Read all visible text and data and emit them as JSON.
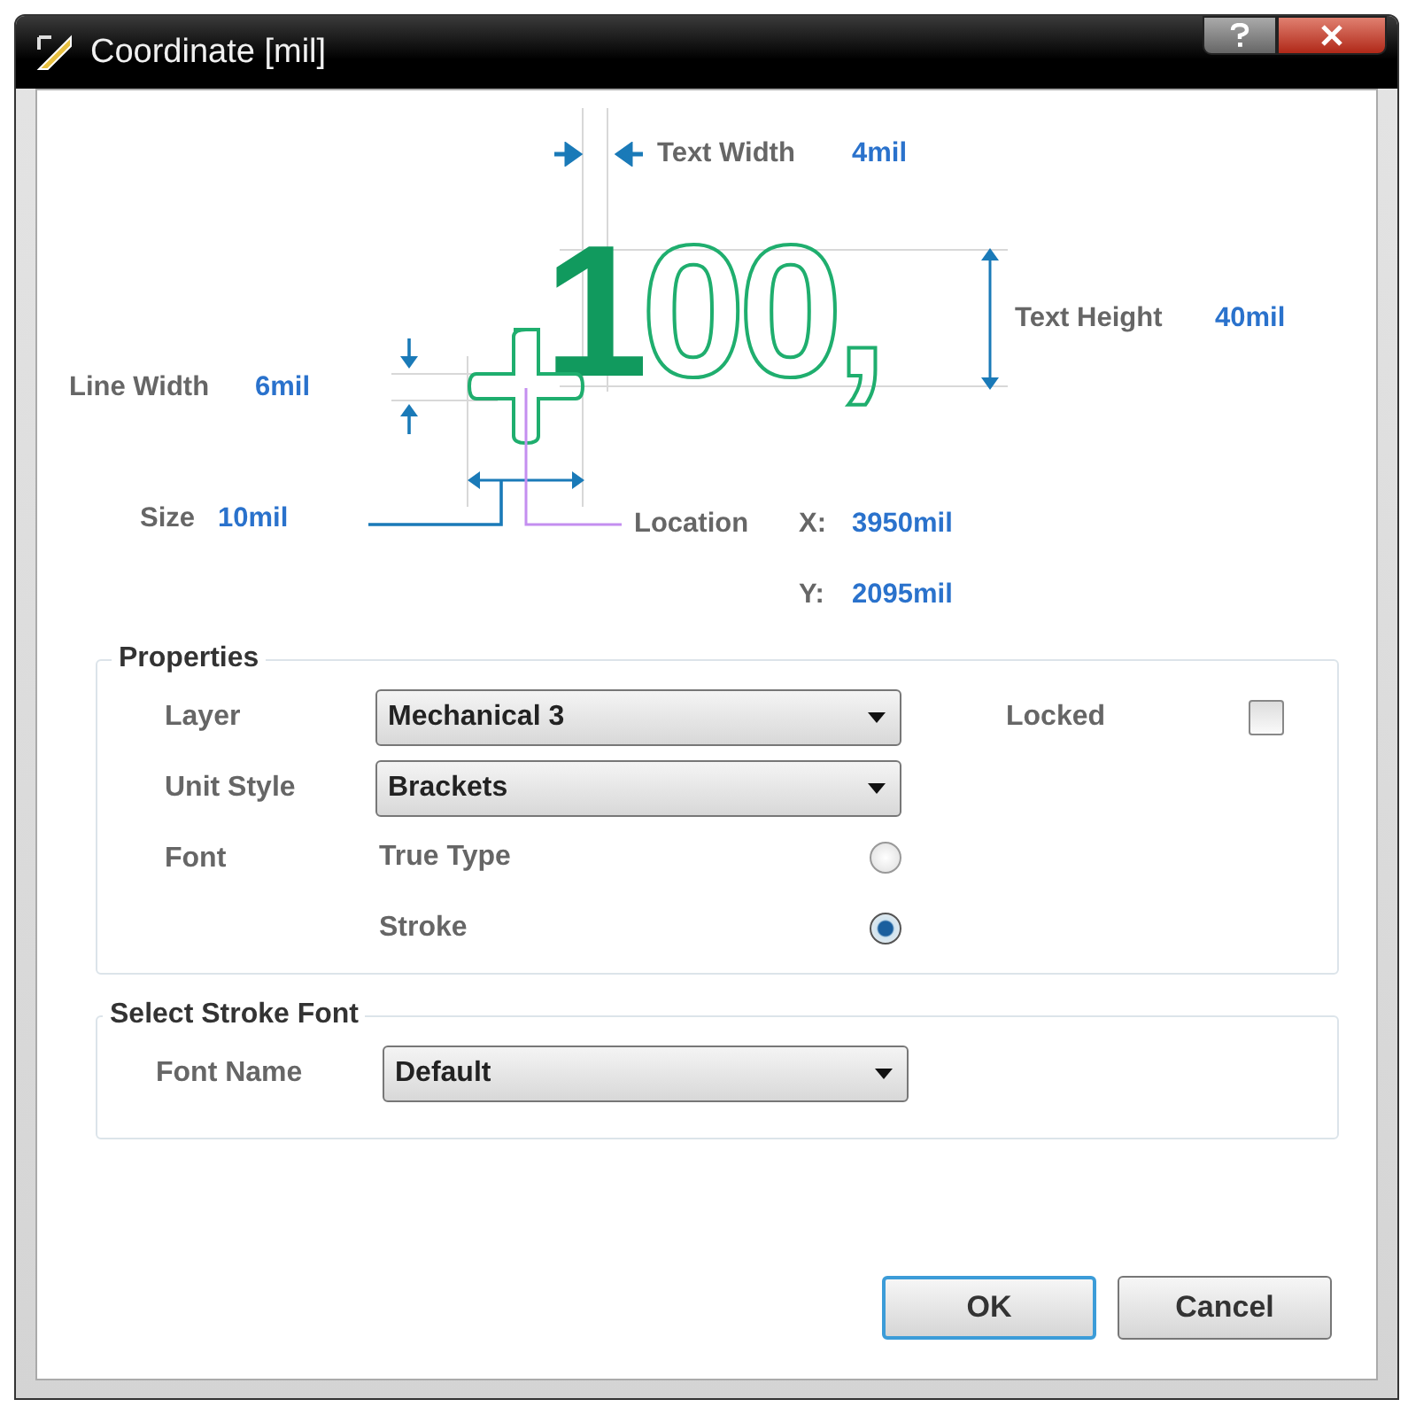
{
  "window": {
    "title": "Coordinate [mil]"
  },
  "diagram": {
    "text_width": {
      "label": "Text Width",
      "value": "4mil"
    },
    "text_height": {
      "label": "Text Height",
      "value": "40mil"
    },
    "line_width": {
      "label": "Line Width",
      "value": "6mil"
    },
    "size": {
      "label": "Size",
      "value": "10mil"
    },
    "location": {
      "label": "Location",
      "x_label": "X:",
      "x_value": "3950mil",
      "y_label": "Y:",
      "y_value": "2095mil"
    },
    "sample": [
      {
        "text": "1",
        "kind": "filled"
      },
      {
        "text": "00,",
        "kind": "outline"
      }
    ]
  },
  "properties": {
    "title": "Properties",
    "layer": {
      "label": "Layer",
      "value": "Mechanical 3"
    },
    "unit_style": {
      "label": "Unit Style",
      "value": "Brackets"
    },
    "locked": {
      "label": "Locked",
      "checked": false
    },
    "font": {
      "label": "Font",
      "options": [
        {
          "label": "True Type",
          "selected": false
        },
        {
          "label": "Stroke",
          "selected": true
        }
      ]
    }
  },
  "stroke_font": {
    "title": "Select Stroke Font",
    "font_name": {
      "label": "Font Name",
      "value": "Default"
    }
  },
  "buttons": [
    {
      "label": "OK",
      "default": true
    },
    {
      "label": "Cancel",
      "default": false
    }
  ]
}
